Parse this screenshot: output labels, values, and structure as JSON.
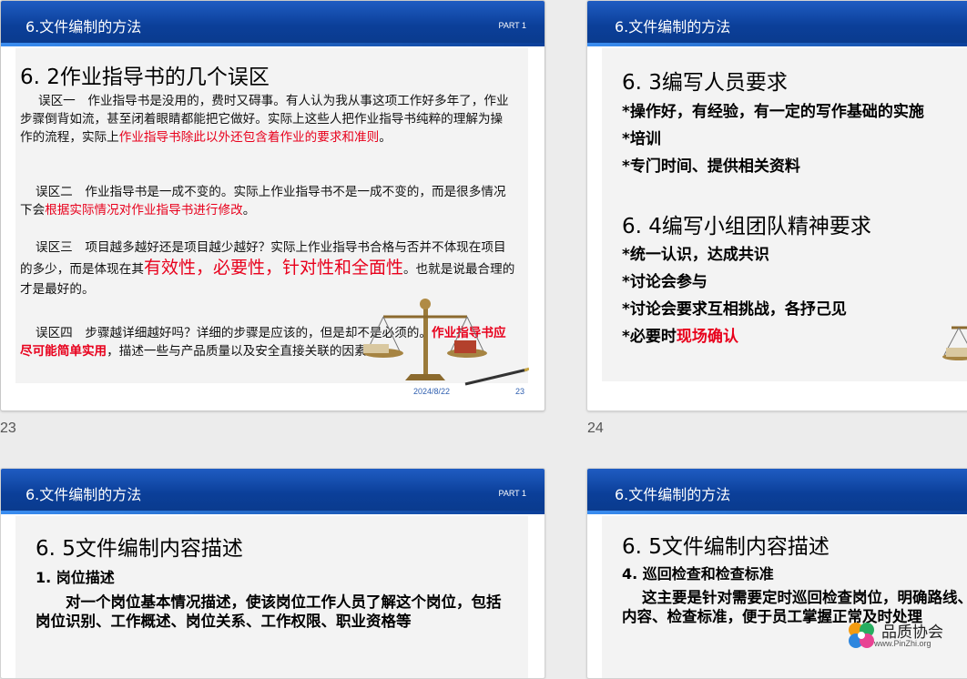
{
  "slides": [
    {
      "header_title": "6.文件编制的方法",
      "part_label": "PART 1",
      "heading": "6. 2作业指导书的几个误区",
      "p1_a": "误区一　作业指导书是没用的，费时又碍事。有人认为我从事这项工作好多年了，作业步骤倒背如流，甚至闭着眼睛都能把它做好。实际上这些人把作业指导书纯粹的理解为操作的流程，实际上",
      "p1_red": "作业指导书除此以外还包含着作业的要求和准则",
      "p1_end": "。",
      "p2_a": "误区二　作业指导书是一成不变的。实际上作业指导书不是一成不变的，而是很多情况下会",
      "p2_red": "根据实际情况对作业指导书进行修改",
      "p2_end": "。",
      "p3_a": "误区三　项目越多越好还是项目越少越好？实际上作业指导书合格与否并不体现在项目的多少，而是体现在其",
      "p3_red": "有效性，必要性，针对性和全面性",
      "p3_end": "。也就是说最合理的才是最好的。",
      "p4_a": "误区四　步骤越详细越好吗？详细的步骤是应该的，但是却不是必须的。",
      "p4_red": "作业指导书应尽可能简单实用",
      "p4_end": "，描述一些与产品质量以及安全直接关联的因素。",
      "date": "2024/8/22",
      "page": "23",
      "number": "23"
    },
    {
      "header_title": "6.文件编制的方法",
      "heading1": "6. 3编写人员要求",
      "lines1": [
        "*操作好，有经验，有一定的写作基础的实施",
        "*培训",
        "*专门时间、提供相关资料"
      ],
      "heading2": "6. 4编写小组团队精神要求",
      "lines2": [
        "*统一认识，达成共识",
        "*讨论会参与",
        "*讨论会要求互相挑战，各抒己见"
      ],
      "line_last_a": "*必要时",
      "line_last_red": "现场确认",
      "number": "24"
    },
    {
      "header_title": "6.文件编制的方法",
      "part_label": "PART 1",
      "heading": "6. 5文件编制内容描述",
      "subheading": "1. 岗位描述",
      "body": "对一个岗位基本情况描述，使该岗位工作人员了解这个岗位，包括岗位识别、工作概述、岗位关系、工作权限、职业资格等"
    },
    {
      "header_title": "6.文件编制的方法",
      "heading": "6. 5文件编制内容描述",
      "subheading": "4. 巡回检查和检查标准",
      "body": "这主要是针对需要定时巡回检查岗位，明确路线、内容、检查标准，便于员工掌握正常及时处理"
    }
  ],
  "watermark": {
    "name": "品质协会",
    "url": "www.PinZhi.org"
  }
}
